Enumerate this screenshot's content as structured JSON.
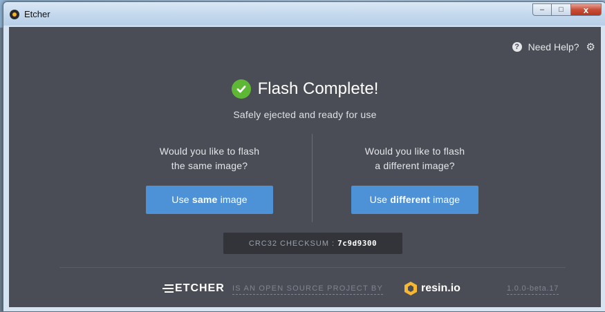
{
  "window": {
    "title": "Etcher",
    "minimize": "–",
    "maximize": "□",
    "close": "x"
  },
  "header": {
    "help_label": "Need Help?",
    "help_icon": "question-circle-icon",
    "settings_icon": "gear-icon"
  },
  "status": {
    "title": "Flash Complete!",
    "subtitle": "Safely ejected and ready for use",
    "icon": "check-circle-icon",
    "accent_color": "#5fb835"
  },
  "same_image": {
    "question_line1": "Would you like to flash",
    "question_line2": "the same image?",
    "button_prefix": "Use ",
    "button_bold": "same",
    "button_suffix": " image"
  },
  "different_image": {
    "question_line1": "Would you like to flash",
    "question_line2": "a different image?",
    "button_prefix": "Use ",
    "button_bold": "different",
    "button_suffix": " image"
  },
  "checksum": {
    "label": "CRC32 CHECKSUM :",
    "value": "7c9d9300"
  },
  "footer": {
    "etcher_logo": "ETCHER",
    "oss_text": "IS AN OPEN SOURCE PROJECT BY",
    "resin_logo": "resin.io",
    "version": "1.0.0-beta.17"
  },
  "colors": {
    "background": "#4a4d56",
    "button": "#4d92d7",
    "checksum_bg": "#323439"
  }
}
